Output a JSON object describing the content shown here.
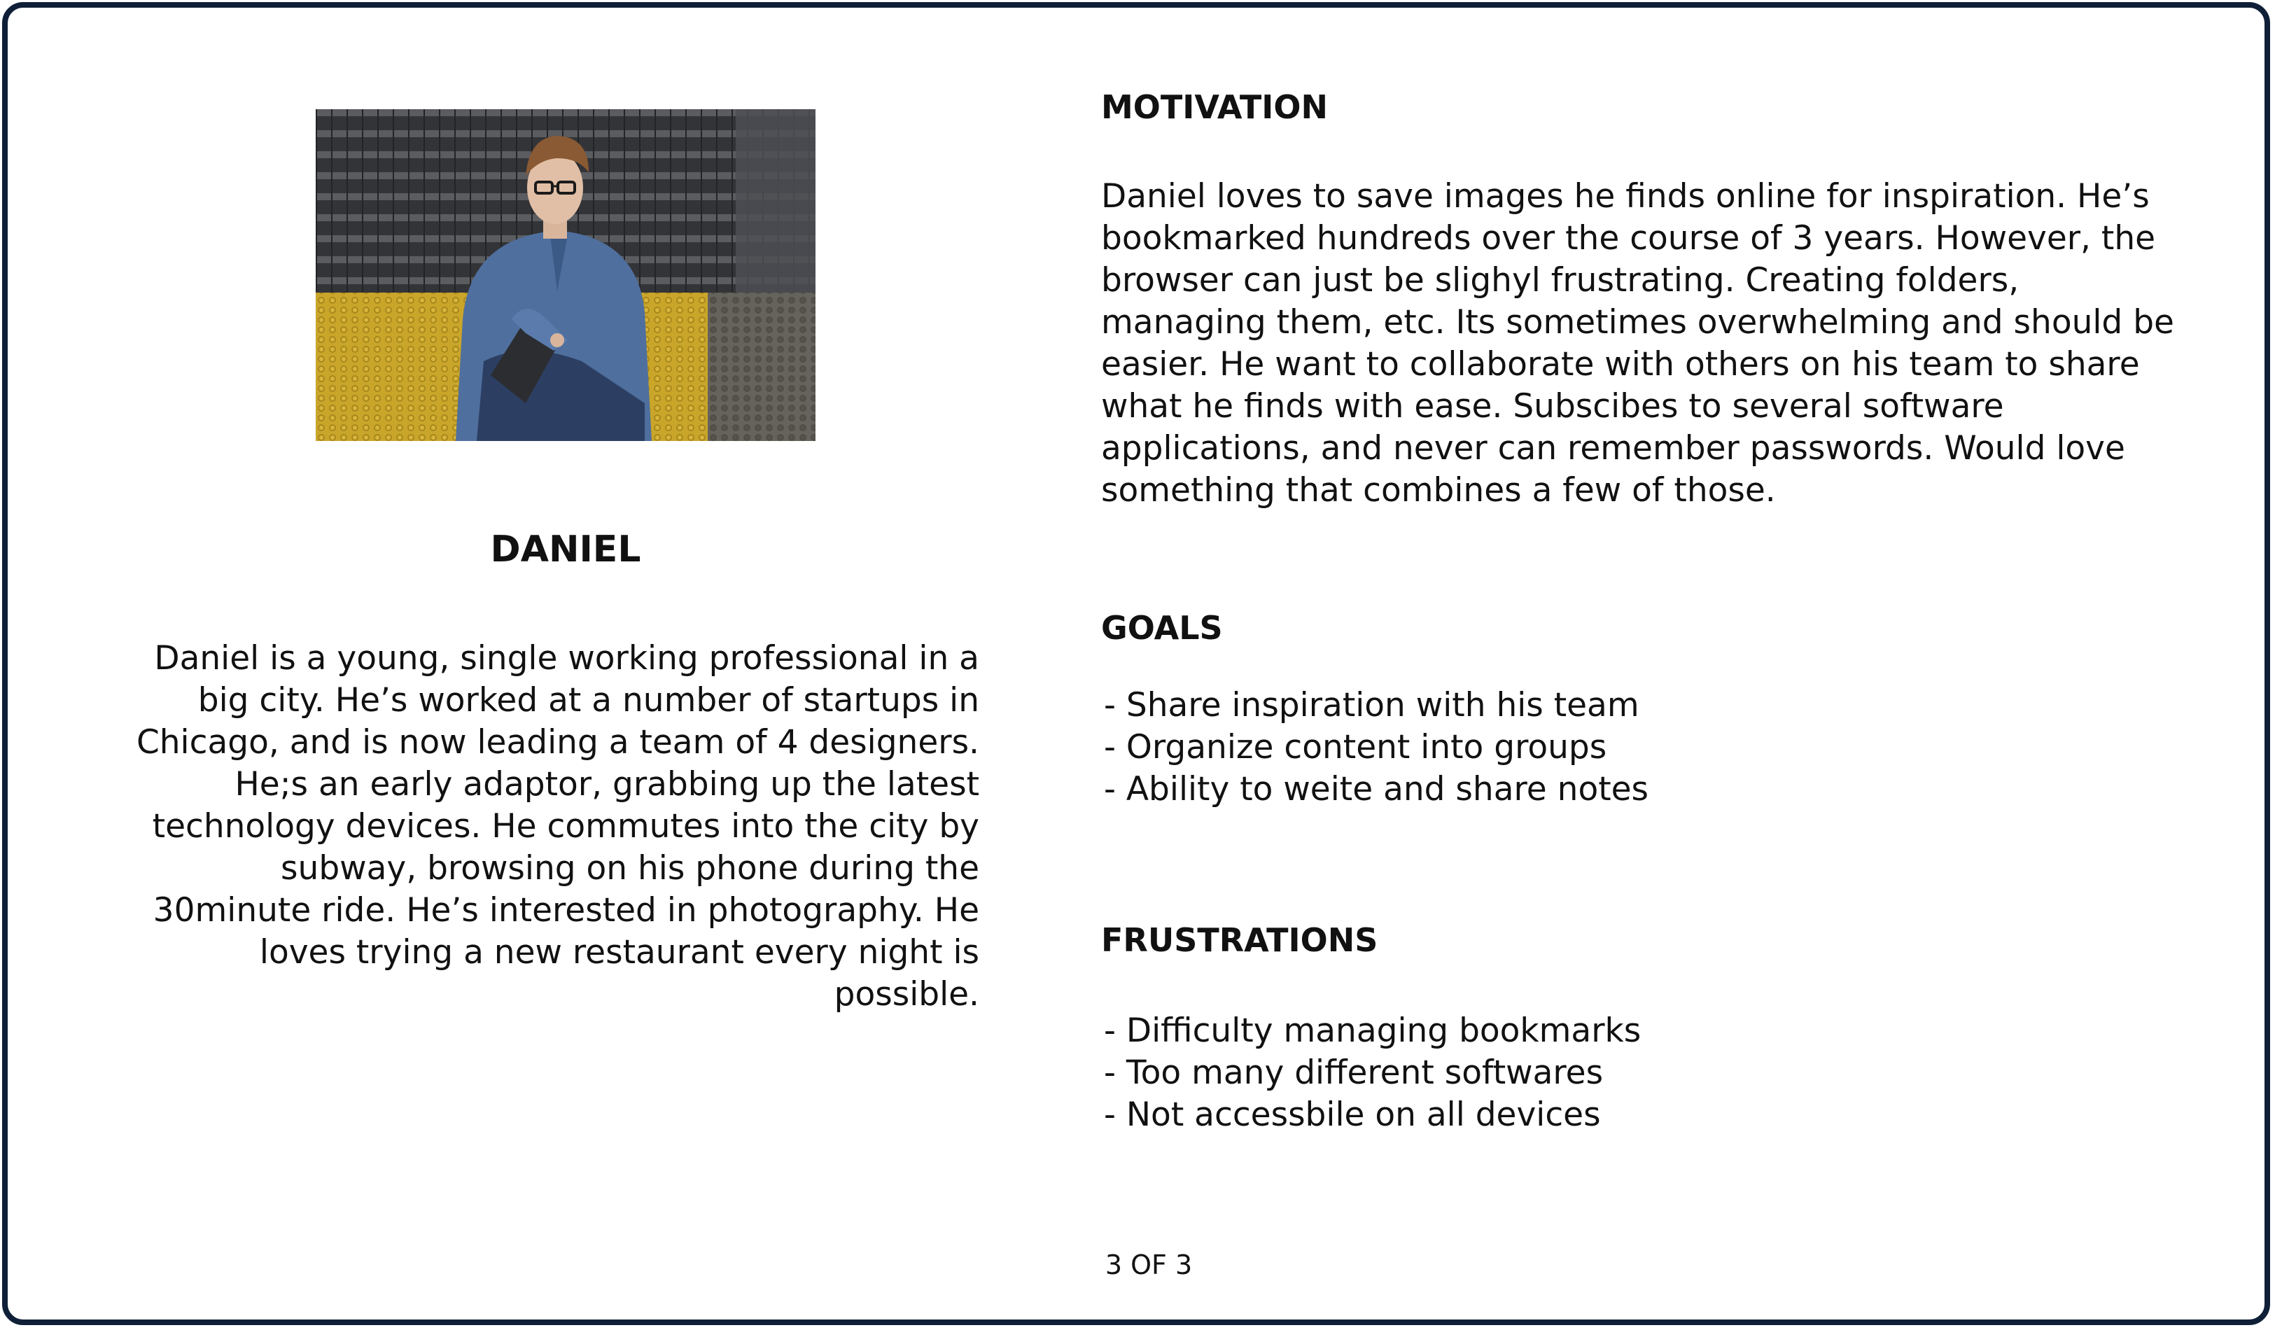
{
  "persona": {
    "name": "DANIEL",
    "bio": "Daniel is a young, single working professional in a big city. He’s worked at a number of startups in Chicago, and is now leading a team of 4 designers. He;s an early adaptor, grabbing up the latest technology devices. He commutes into the city by subway, browsing on his phone during the 30minute ride. He’s interested in photography. He loves trying a new restaurant every night is possible."
  },
  "motivation": {
    "heading": "MOTIVATION",
    "text": "Daniel loves to save images he finds online for inspiration. He’s bookmarked hundreds over the course of 3 years. However, the browser can just be slighyl frustrating. Creating folders, managing them, etc. Its sometimes overwhelming and should be easier. He want to collaborate with others on his team to share what he finds with ease. Subscibes to several software applications, and never can remember passwords. Would love something that combines a few of those."
  },
  "goals": {
    "heading": "GOALS",
    "items": [
      "- Share inspiration with his team",
      "- Organize content into groups",
      "- Ability to weite and share notes"
    ]
  },
  "frustrations": {
    "heading": "FRUSTRATIONS",
    "items": [
      "- Difficulty managing bookmarks",
      "- Too many different softwares",
      "- Not accessbile on all devices"
    ]
  },
  "page_number": "3 OF 3",
  "colors": {
    "frame_border": "#0f1f38",
    "text": "#111111",
    "background": "#ffffff"
  }
}
